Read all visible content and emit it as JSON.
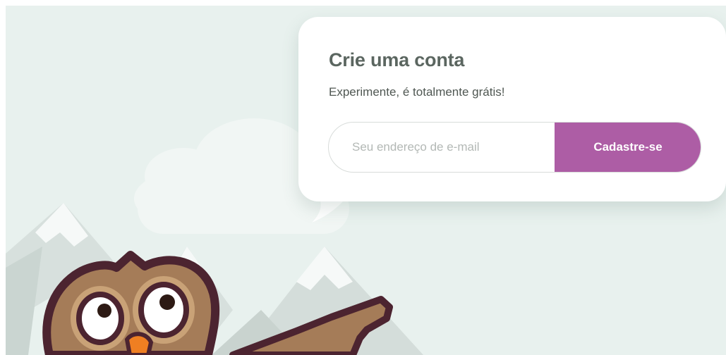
{
  "signup_card": {
    "title": "Crie uma conta",
    "subtitle": "Experimente, é totalmente grátis!",
    "email_placeholder": "Seu endereço de e-mail",
    "submit_label": "Cadastre-se"
  },
  "colors": {
    "background": "#e8f1ee",
    "accent": "#ad5da5",
    "title": "#5b6660"
  },
  "illustration": {
    "mascot": "owl-mascot",
    "scenery": [
      "mountains",
      "cloud",
      "speech-bubble"
    ]
  }
}
